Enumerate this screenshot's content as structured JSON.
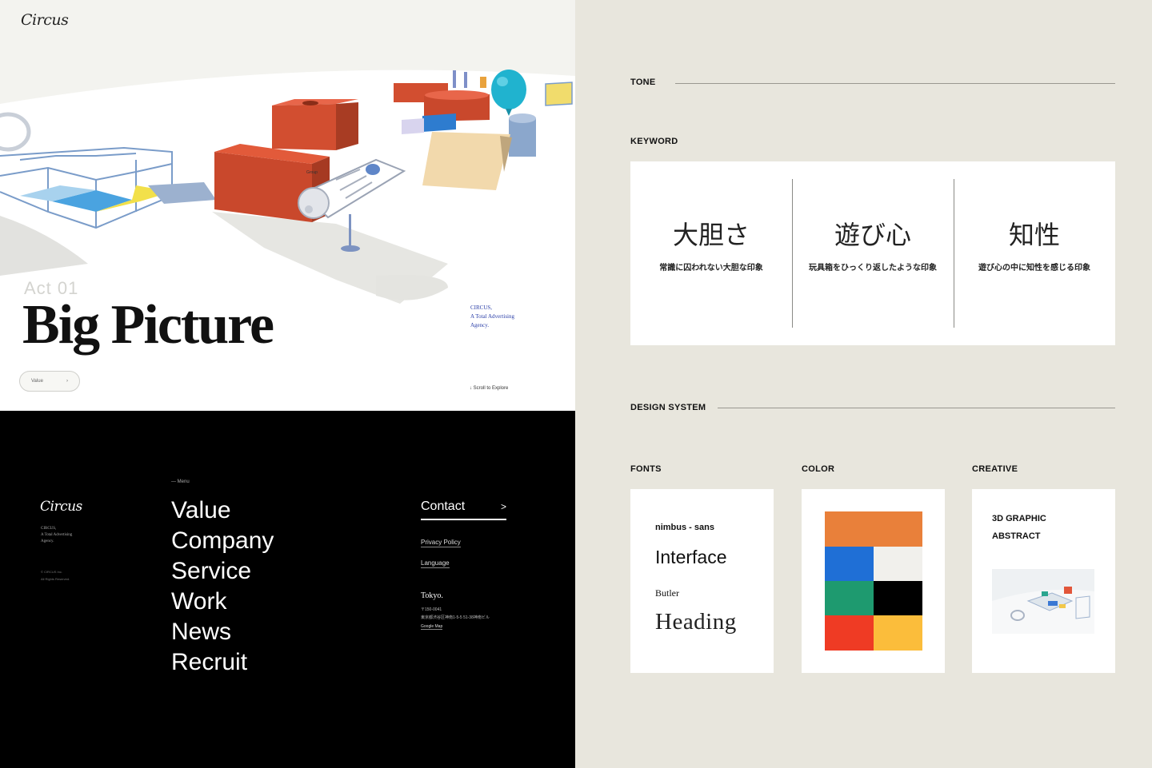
{
  "hero": {
    "logo": "Circus",
    "act": "Act 01",
    "title": "Big Picture",
    "pill_label": "Value",
    "pill_icon": "chevron-right-icon",
    "agency": [
      "CIRCUS,",
      "A Total Advertising",
      "Agency."
    ],
    "scroll_hint": "Scroll to Explore"
  },
  "menu": {
    "logo": "Circus",
    "agency": [
      "CIRCUS,",
      "A Total Advertising",
      "Agency."
    ],
    "copyright": [
      "© CIRCUS Inc.",
      "All Rights Reserved."
    ],
    "label": "Menu",
    "items": [
      "Value",
      "Company",
      "Service",
      "Work",
      "News",
      "Recruit"
    ],
    "contact": "Contact",
    "contact_arrow": ">",
    "privacy": "Privacy Policy",
    "language": "Language",
    "office": "Tokyo.",
    "address": [
      "〒150-0041",
      "東京都渋谷区神南1-5-5 51-38神南ビル"
    ],
    "google_map": "Google Map"
  },
  "panel": {
    "tone_label": "TONE",
    "keyword_label": "KEYWORD",
    "keywords": [
      {
        "title": "大胆さ",
        "desc": "常識に囚われない大胆な印象"
      },
      {
        "title": "遊び心",
        "desc": "玩具箱をひっくり返したような印象"
      },
      {
        "title": "知性",
        "desc": "遊び心の中に知性を感じる印象"
      }
    ],
    "design_system_label": "DESIGN SYSTEM",
    "fonts_label": "FONTS",
    "color_label": "COLOR",
    "creative_label": "CREATIVE",
    "fonts": {
      "nimbus": "nimbus - sans",
      "interface": "Interface",
      "butler": "Butler",
      "heading": "Heading"
    },
    "colors": [
      "#e9803a",
      "#1f6fd6",
      "#f1f0ec",
      "#1e9a6f",
      "#000000",
      "#ef3b24",
      "#fbbd3b"
    ],
    "creative": [
      "3D GRAPHIC",
      "ABSTRACT"
    ]
  }
}
